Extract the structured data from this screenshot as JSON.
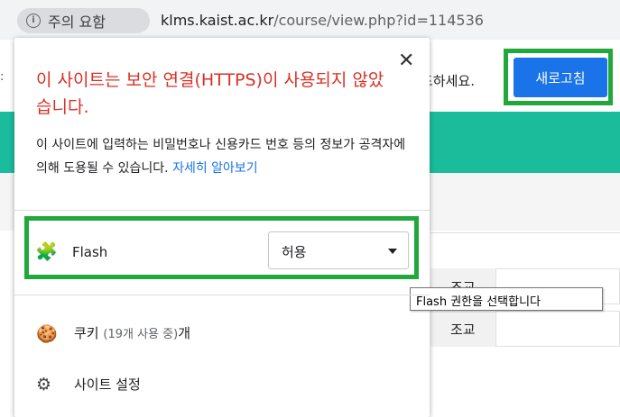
{
  "address_bar": {
    "security_chip": "주의 요함",
    "url_host": "klms.kaist.ac.kr",
    "url_path": "/course/view.php?id=114536"
  },
  "page": {
    "warning_tail": "드하세요.",
    "reload_button": "새로고침",
    "table_labels": [
      "조교",
      "조교"
    ]
  },
  "popup": {
    "title": "이 사이트는 보안 연결(HTTPS)이 사용되지 않았습니다.",
    "description": "이 사이트에 입력하는 비밀번호나 신용카드 번호 등의 정보가 공격자에 의해 도용될 수 있습니다.",
    "learn_more": "자세히 알아보기",
    "flash": {
      "label": "Flash",
      "selected": "허용",
      "tooltip": "Flash 권한을 선택합니다"
    },
    "cookies": {
      "label": "쿠키",
      "count": "(19개 사용 중)",
      "suffix": "개"
    },
    "site_settings": "사이트 설정"
  },
  "colors": {
    "accent_green": "#21a83d",
    "teal": "#1abc9c",
    "button_blue": "#1a73e8",
    "warning_red": "#d93025"
  },
  "icons": [
    "info-icon",
    "close-icon",
    "puzzle-icon",
    "cookie-icon",
    "gear-icon"
  ]
}
